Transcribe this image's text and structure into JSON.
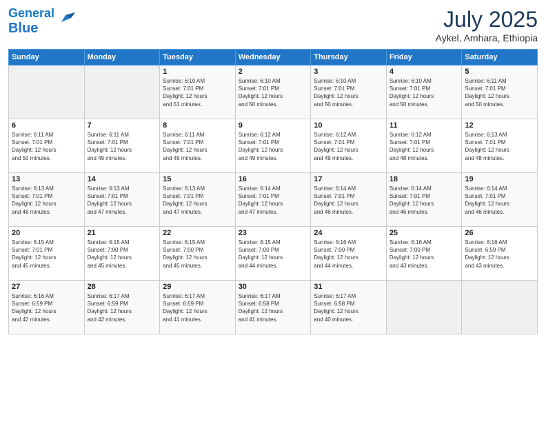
{
  "logo": {
    "line1": "General",
    "line2": "Blue"
  },
  "title": "July 2025",
  "subtitle": "Aykel, Amhara, Ethiopia",
  "days_of_week": [
    "Sunday",
    "Monday",
    "Tuesday",
    "Wednesday",
    "Thursday",
    "Friday",
    "Saturday"
  ],
  "weeks": [
    [
      {
        "day": "",
        "info": ""
      },
      {
        "day": "",
        "info": ""
      },
      {
        "day": "1",
        "info": "Sunrise: 6:10 AM\nSunset: 7:01 PM\nDaylight: 12 hours\nand 51 minutes."
      },
      {
        "day": "2",
        "info": "Sunrise: 6:10 AM\nSunset: 7:01 PM\nDaylight: 12 hours\nand 50 minutes."
      },
      {
        "day": "3",
        "info": "Sunrise: 6:10 AM\nSunset: 7:01 PM\nDaylight: 12 hours\nand 50 minutes."
      },
      {
        "day": "4",
        "info": "Sunrise: 6:10 AM\nSunset: 7:01 PM\nDaylight: 12 hours\nand 50 minutes."
      },
      {
        "day": "5",
        "info": "Sunrise: 6:11 AM\nSunset: 7:01 PM\nDaylight: 12 hours\nand 50 minutes."
      }
    ],
    [
      {
        "day": "6",
        "info": "Sunrise: 6:11 AM\nSunset: 7:01 PM\nDaylight: 12 hours\nand 50 minutes."
      },
      {
        "day": "7",
        "info": "Sunrise: 6:11 AM\nSunset: 7:01 PM\nDaylight: 12 hours\nand 49 minutes."
      },
      {
        "day": "8",
        "info": "Sunrise: 6:11 AM\nSunset: 7:01 PM\nDaylight: 12 hours\nand 49 minutes."
      },
      {
        "day": "9",
        "info": "Sunrise: 6:12 AM\nSunset: 7:01 PM\nDaylight: 12 hours\nand 49 minutes."
      },
      {
        "day": "10",
        "info": "Sunrise: 6:12 AM\nSunset: 7:01 PM\nDaylight: 12 hours\nand 49 minutes."
      },
      {
        "day": "11",
        "info": "Sunrise: 6:12 AM\nSunset: 7:01 PM\nDaylight: 12 hours\nand 48 minutes."
      },
      {
        "day": "12",
        "info": "Sunrise: 6:13 AM\nSunset: 7:01 PM\nDaylight: 12 hours\nand 48 minutes."
      }
    ],
    [
      {
        "day": "13",
        "info": "Sunrise: 6:13 AM\nSunset: 7:01 PM\nDaylight: 12 hours\nand 48 minutes."
      },
      {
        "day": "14",
        "info": "Sunrise: 6:13 AM\nSunset: 7:01 PM\nDaylight: 12 hours\nand 47 minutes."
      },
      {
        "day": "15",
        "info": "Sunrise: 6:13 AM\nSunset: 7:01 PM\nDaylight: 12 hours\nand 47 minutes."
      },
      {
        "day": "16",
        "info": "Sunrise: 6:14 AM\nSunset: 7:01 PM\nDaylight: 12 hours\nand 47 minutes."
      },
      {
        "day": "17",
        "info": "Sunrise: 6:14 AM\nSunset: 7:01 PM\nDaylight: 12 hours\nand 46 minutes."
      },
      {
        "day": "18",
        "info": "Sunrise: 6:14 AM\nSunset: 7:01 PM\nDaylight: 12 hours\nand 46 minutes."
      },
      {
        "day": "19",
        "info": "Sunrise: 6:14 AM\nSunset: 7:01 PM\nDaylight: 12 hours\nand 46 minutes."
      }
    ],
    [
      {
        "day": "20",
        "info": "Sunrise: 6:15 AM\nSunset: 7:01 PM\nDaylight: 12 hours\nand 45 minutes."
      },
      {
        "day": "21",
        "info": "Sunrise: 6:15 AM\nSunset: 7:00 PM\nDaylight: 12 hours\nand 45 minutes."
      },
      {
        "day": "22",
        "info": "Sunrise: 6:15 AM\nSunset: 7:00 PM\nDaylight: 12 hours\nand 45 minutes."
      },
      {
        "day": "23",
        "info": "Sunrise: 6:15 AM\nSunset: 7:00 PM\nDaylight: 12 hours\nand 44 minutes."
      },
      {
        "day": "24",
        "info": "Sunrise: 6:16 AM\nSunset: 7:00 PM\nDaylight: 12 hours\nand 44 minutes."
      },
      {
        "day": "25",
        "info": "Sunrise: 6:16 AM\nSunset: 7:00 PM\nDaylight: 12 hours\nand 43 minutes."
      },
      {
        "day": "26",
        "info": "Sunrise: 6:16 AM\nSunset: 6:59 PM\nDaylight: 12 hours\nand 43 minutes."
      }
    ],
    [
      {
        "day": "27",
        "info": "Sunrise: 6:16 AM\nSunset: 6:59 PM\nDaylight: 12 hours\nand 42 minutes."
      },
      {
        "day": "28",
        "info": "Sunrise: 6:17 AM\nSunset: 6:59 PM\nDaylight: 12 hours\nand 42 minutes."
      },
      {
        "day": "29",
        "info": "Sunrise: 6:17 AM\nSunset: 6:59 PM\nDaylight: 12 hours\nand 41 minutes."
      },
      {
        "day": "30",
        "info": "Sunrise: 6:17 AM\nSunset: 6:58 PM\nDaylight: 12 hours\nand 41 minutes."
      },
      {
        "day": "31",
        "info": "Sunrise: 6:17 AM\nSunset: 6:58 PM\nDaylight: 12 hours\nand 40 minutes."
      },
      {
        "day": "",
        "info": ""
      },
      {
        "day": "",
        "info": ""
      }
    ]
  ]
}
